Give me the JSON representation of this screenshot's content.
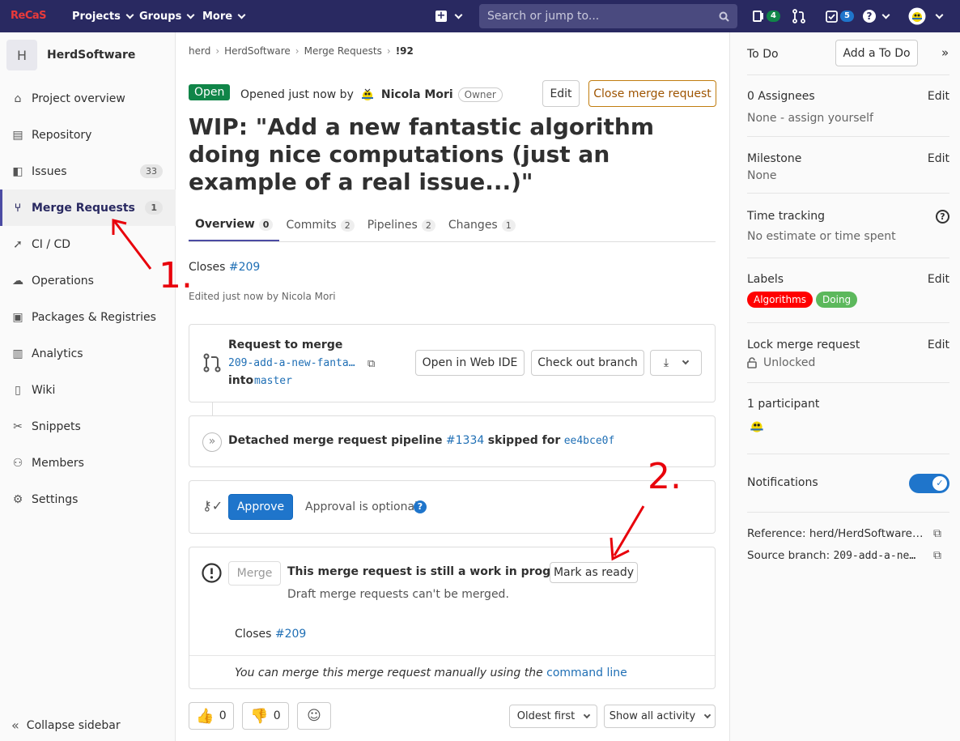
{
  "topbar": {
    "logo": "ReCaS",
    "nav": [
      "Projects",
      "Groups",
      "More"
    ],
    "search_placeholder": "Search or jump to...",
    "issues_count": "4",
    "todos_count": "5"
  },
  "sidebar": {
    "project_initial": "H",
    "project_name": "HerdSoftware",
    "items": [
      {
        "label": "Project overview",
        "icon": "home-icon"
      },
      {
        "label": "Repository",
        "icon": "doc-icon"
      },
      {
        "label": "Issues",
        "icon": "issues-icon",
        "count": "33"
      },
      {
        "label": "Merge Requests",
        "icon": "merge-request-icon",
        "count": "1"
      },
      {
        "label": "CI / CD",
        "icon": "rocket-icon"
      },
      {
        "label": "Operations",
        "icon": "cloud-icon"
      },
      {
        "label": "Packages & Registries",
        "icon": "package-icon"
      },
      {
        "label": "Analytics",
        "icon": "chart-icon"
      },
      {
        "label": "Wiki",
        "icon": "book-icon"
      },
      {
        "label": "Snippets",
        "icon": "scissors-icon"
      },
      {
        "label": "Members",
        "icon": "users-icon"
      },
      {
        "label": "Settings",
        "icon": "gear-icon"
      }
    ],
    "collapse_label": "Collapse sidebar"
  },
  "breadcrumb": [
    "herd",
    "HerdSoftware",
    "Merge Requests",
    "!92"
  ],
  "mr": {
    "status": "Open",
    "opened_text": "Opened just now by",
    "author": "Nicola Mori",
    "role": "Owner",
    "edit_label": "Edit",
    "close_label": "Close merge request",
    "title": "WIP: \"Add a new fantastic algorithm doing nice computations (just an example of a real issue...)\"",
    "tabs": [
      {
        "label": "Overview",
        "count": "0"
      },
      {
        "label": "Commits",
        "count": "2"
      },
      {
        "label": "Pipelines",
        "count": "2"
      },
      {
        "label": "Changes",
        "count": "1"
      }
    ],
    "closes_label": "Closes",
    "closes_issue": "#209",
    "edited_text": "Edited just now by Nicola Mori"
  },
  "request": {
    "heading": "Request to merge",
    "source_branch": "209-add-a-new-fanta…",
    "into": "into",
    "target_branch": "master",
    "web_ide": "Open in Web IDE",
    "checkout": "Check out branch"
  },
  "pipeline": {
    "text1": "Detached merge request pipeline",
    "id": "#1334",
    "text2": "skipped for",
    "sha": "ee4bce0f"
  },
  "approve": {
    "button": "Approve",
    "text": "Approval is optional"
  },
  "merge": {
    "button": "Merge",
    "wip_text": "This merge request is still a work in progress.",
    "mark_ready": "Mark as ready",
    "draft_note": "Draft merge requests can't be merged.",
    "closes_label": "Closes",
    "closes_issue": "#209",
    "manual_text": "You can merge this merge request manually using the",
    "command_line": "command line"
  },
  "footer": {
    "thumbs_up": "0",
    "thumbs_down": "0",
    "sort": "Oldest first",
    "activity": "Show all activity"
  },
  "right": {
    "todo_label": "To Do",
    "add_todo": "Add a To Do",
    "assignees": "0 Assignees",
    "assignees_val": "None - assign yourself",
    "milestone": "Milestone",
    "milestone_val": "None",
    "time": "Time tracking",
    "time_val": "No estimate or time spent",
    "labels": "Labels",
    "label_list": [
      {
        "text": "Algorithms",
        "color": "#ff0000"
      },
      {
        "text": "Doing",
        "color": "#5cb85c"
      }
    ],
    "lock": "Lock merge request",
    "lock_val": "Unlocked",
    "participants": "1 participant",
    "notifications": "Notifications",
    "reference": "Reference: herd/HerdSoftware…",
    "source_branch_label": "Source branch:",
    "source_branch_val": "209-add-a-ne…",
    "edit": "Edit"
  },
  "annotations": {
    "step1": "1.",
    "step2": "2.",
    "color": "#e8000b"
  }
}
